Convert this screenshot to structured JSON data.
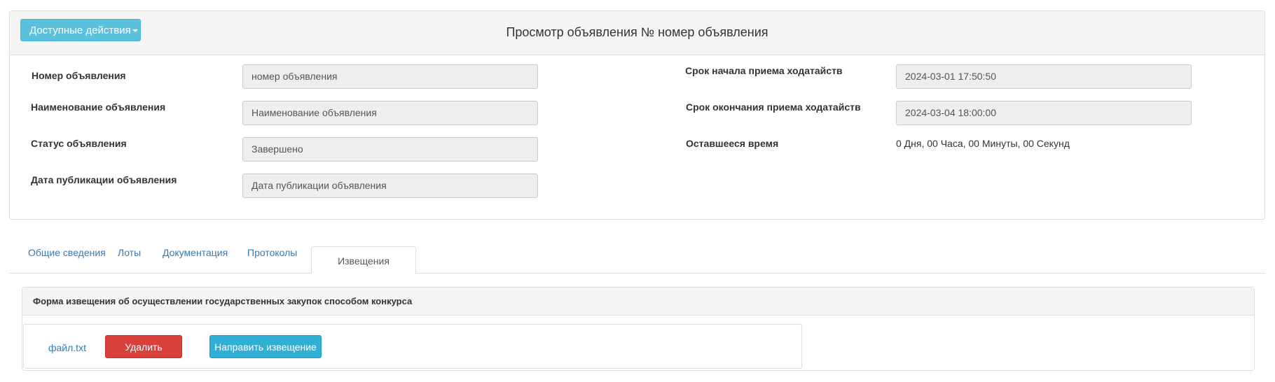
{
  "header": {
    "actions_label": "Доступные действия",
    "title": "Просмотр объявления № номер объявления"
  },
  "details": {
    "left": [
      {
        "label": "Номер объявления",
        "value": "номер объявления"
      },
      {
        "label": "Наименование объявления",
        "value": "Наименование объявления"
      },
      {
        "label": "Статус объявления",
        "value": "Завершено"
      },
      {
        "label": "Дата публикации объявления",
        "value": "Дата публикации объявления"
      }
    ],
    "right": [
      {
        "label": "Срок начала приема ходатайств",
        "value": "2024-03-01 17:50:50"
      },
      {
        "label": "Срок окончания приема ходатайств",
        "value": "2024-03-04 18:00:00"
      },
      {
        "label": "Оставшееся время",
        "value": "0 Дня, 00 Часа, 00 Минуты, 00 Секунд"
      }
    ]
  },
  "tabs": [
    {
      "label": "Общие сведения"
    },
    {
      "label": "Лоты"
    },
    {
      "label": "Документация"
    },
    {
      "label": "Протоколы"
    },
    {
      "label": "Извещения",
      "active": true
    }
  ],
  "notice_form": {
    "title": "Форма извещения об осуществлении государственных закупок способом конкурса",
    "file_name": "файл.txt",
    "delete_label": "Удалить",
    "send_label": "Направить извещение"
  },
  "colors": {
    "info": "#5bc0de",
    "danger": "#d9403b",
    "primary_link": "#337ab7"
  },
  "icons": {
    "actions_caret": "caret-down-icon"
  }
}
